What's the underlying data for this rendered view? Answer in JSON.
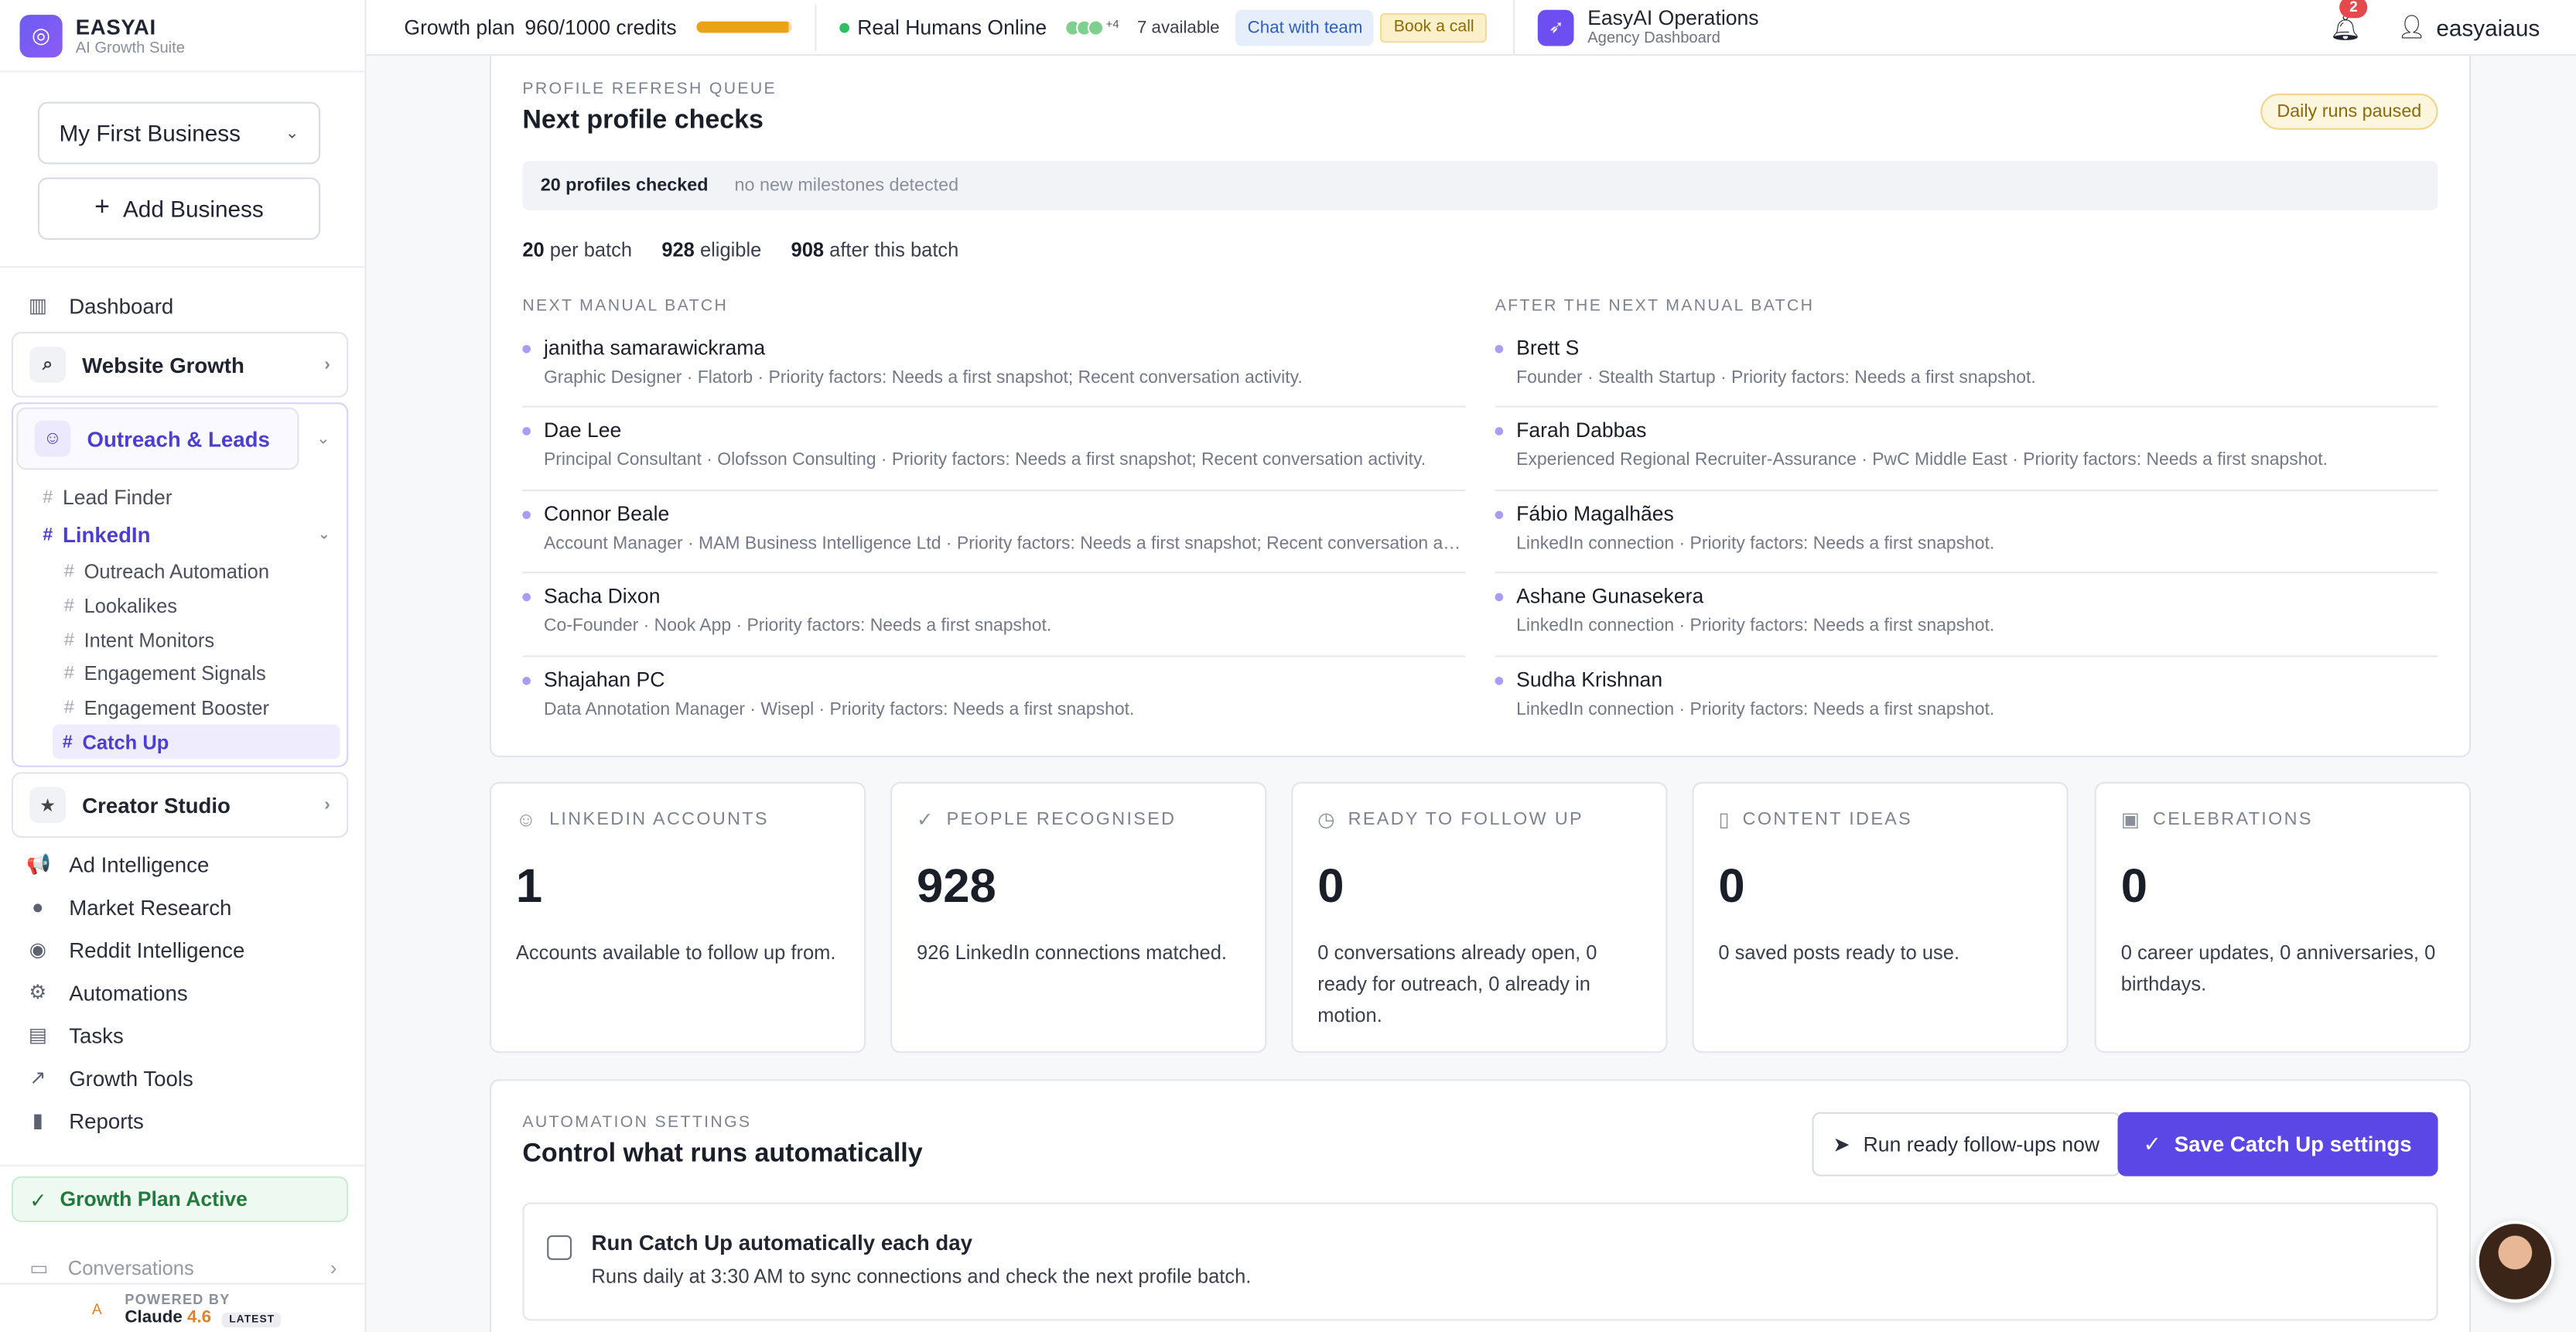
{
  "brand": {
    "name": "EASYAI",
    "subtitle": "AI Growth Suite"
  },
  "sidebar": {
    "business_select": "My First Business",
    "add_business": "Add Business",
    "dashboard": "Dashboard",
    "website_growth": "Website Growth",
    "outreach": "Outreach & Leads",
    "lead_finder": "Lead Finder",
    "linkedin": "LinkedIn",
    "linkedin_items": [
      "Outreach Automation",
      "Lookalikes",
      "Intent Monitors",
      "Engagement Signals",
      "Engagement Booster",
      "Catch Up"
    ],
    "creator_studio": "Creator Studio",
    "nav": [
      "Ad Intelligence",
      "Market Research",
      "Reddit Intelligence",
      "Automations",
      "Tasks",
      "Growth Tools",
      "Reports"
    ],
    "growth_plan_active": "Growth Plan Active",
    "conversations": "Conversations",
    "powered_by": "POWERED BY",
    "model_name": "Claude",
    "model_version": "4.6",
    "model_badge": "LATEST"
  },
  "topbar": {
    "plan": "Growth plan",
    "credits": "960/1000 credits",
    "credits_fraction": 0.96,
    "humans_online": "Real Humans Online",
    "avatars_more": "+4",
    "available": "7 available",
    "chat_with_team": "Chat with team",
    "book_call": "Book a call",
    "ops_title": "EasyAI Operations",
    "ops_subtitle": "Agency Dashboard",
    "notifications": "2",
    "username": "easyaiaus"
  },
  "queue": {
    "eyebrow": "PROFILE REFRESH QUEUE",
    "title": "Next profile checks",
    "status_badge": "Daily runs paused",
    "strip_bold": "20 profiles checked",
    "strip_muted": "no new milestones detected",
    "stats": [
      {
        "value": "20",
        "label": "per batch"
      },
      {
        "value": "928",
        "label": "eligible"
      },
      {
        "value": "908",
        "label": "after this batch"
      }
    ],
    "next_label": "NEXT MANUAL BATCH",
    "after_label": "AFTER THE NEXT MANUAL BATCH",
    "next_batch": [
      {
        "name": "janitha samarawickrama",
        "meta": "Graphic Designer · Flatorb · Priority factors: Needs a first snapshot; Recent conversation activity."
      },
      {
        "name": "Dae Lee",
        "meta": "Principal Consultant · Olofsson Consulting · Priority factors: Needs a first snapshot; Recent conversation activity."
      },
      {
        "name": "Connor Beale",
        "meta": "Account Manager · MAM Business Intelligence Ltd · Priority factors: Needs a first snapshot; Recent conversation activity."
      },
      {
        "name": "Sacha Dixon",
        "meta": "Co-Founder · Nook App · Priority factors: Needs a first snapshot."
      },
      {
        "name": "Shajahan PC",
        "meta": "Data Annotation Manager · Wisepl · Priority factors: Needs a first snapshot."
      }
    ],
    "after_batch": [
      {
        "name": "Brett S",
        "meta": "Founder · Stealth Startup · Priority factors: Needs a first snapshot."
      },
      {
        "name": "Farah Dabbas",
        "meta": "Experienced Regional Recruiter-Assurance · PwC Middle East · Priority factors: Needs a first snapshot."
      },
      {
        "name": "Fábio Magalhães",
        "meta": "LinkedIn connection · Priority factors: Needs a first snapshot."
      },
      {
        "name": "Ashane Gunasekera",
        "meta": "LinkedIn connection · Priority factors: Needs a first snapshot."
      },
      {
        "name": "Sudha Krishnan",
        "meta": "LinkedIn connection · Priority factors: Needs a first snapshot."
      }
    ]
  },
  "stats": [
    {
      "label": "LINKEDIN ACCOUNTS",
      "icon": "users-icon",
      "value": "1",
      "desc": "Accounts available to follow up from."
    },
    {
      "label": "PEOPLE RECOGNISED",
      "icon": "check-circle-icon",
      "value": "928",
      "desc": "926 LinkedIn connections matched."
    },
    {
      "label": "READY TO FOLLOW UP",
      "icon": "clock-icon",
      "value": "0",
      "desc": "0 conversations already open, 0 ready for outreach, 0 already in motion."
    },
    {
      "label": "CONTENT IDEAS",
      "icon": "bookmark-icon",
      "value": "0",
      "desc": "0 saved posts ready to use."
    },
    {
      "label": "CELEBRATIONS",
      "icon": "gift-icon",
      "value": "0",
      "desc": "0 career updates, 0 anniversaries, 0 birthdays."
    }
  ],
  "automation": {
    "eyebrow": "AUTOMATION SETTINGS",
    "title": "Control what runs automatically",
    "run_button": "Run ready follow-ups now",
    "save_button": "Save Catch Up settings",
    "toggle_title": "Run Catch Up automatically each day",
    "toggle_desc": "Runs daily at 3:30 AM to sync connections and check the next profile batch."
  },
  "colors": {
    "accent": "#5b47e6",
    "success": "#2fbf62",
    "warning": "#e8a317"
  }
}
